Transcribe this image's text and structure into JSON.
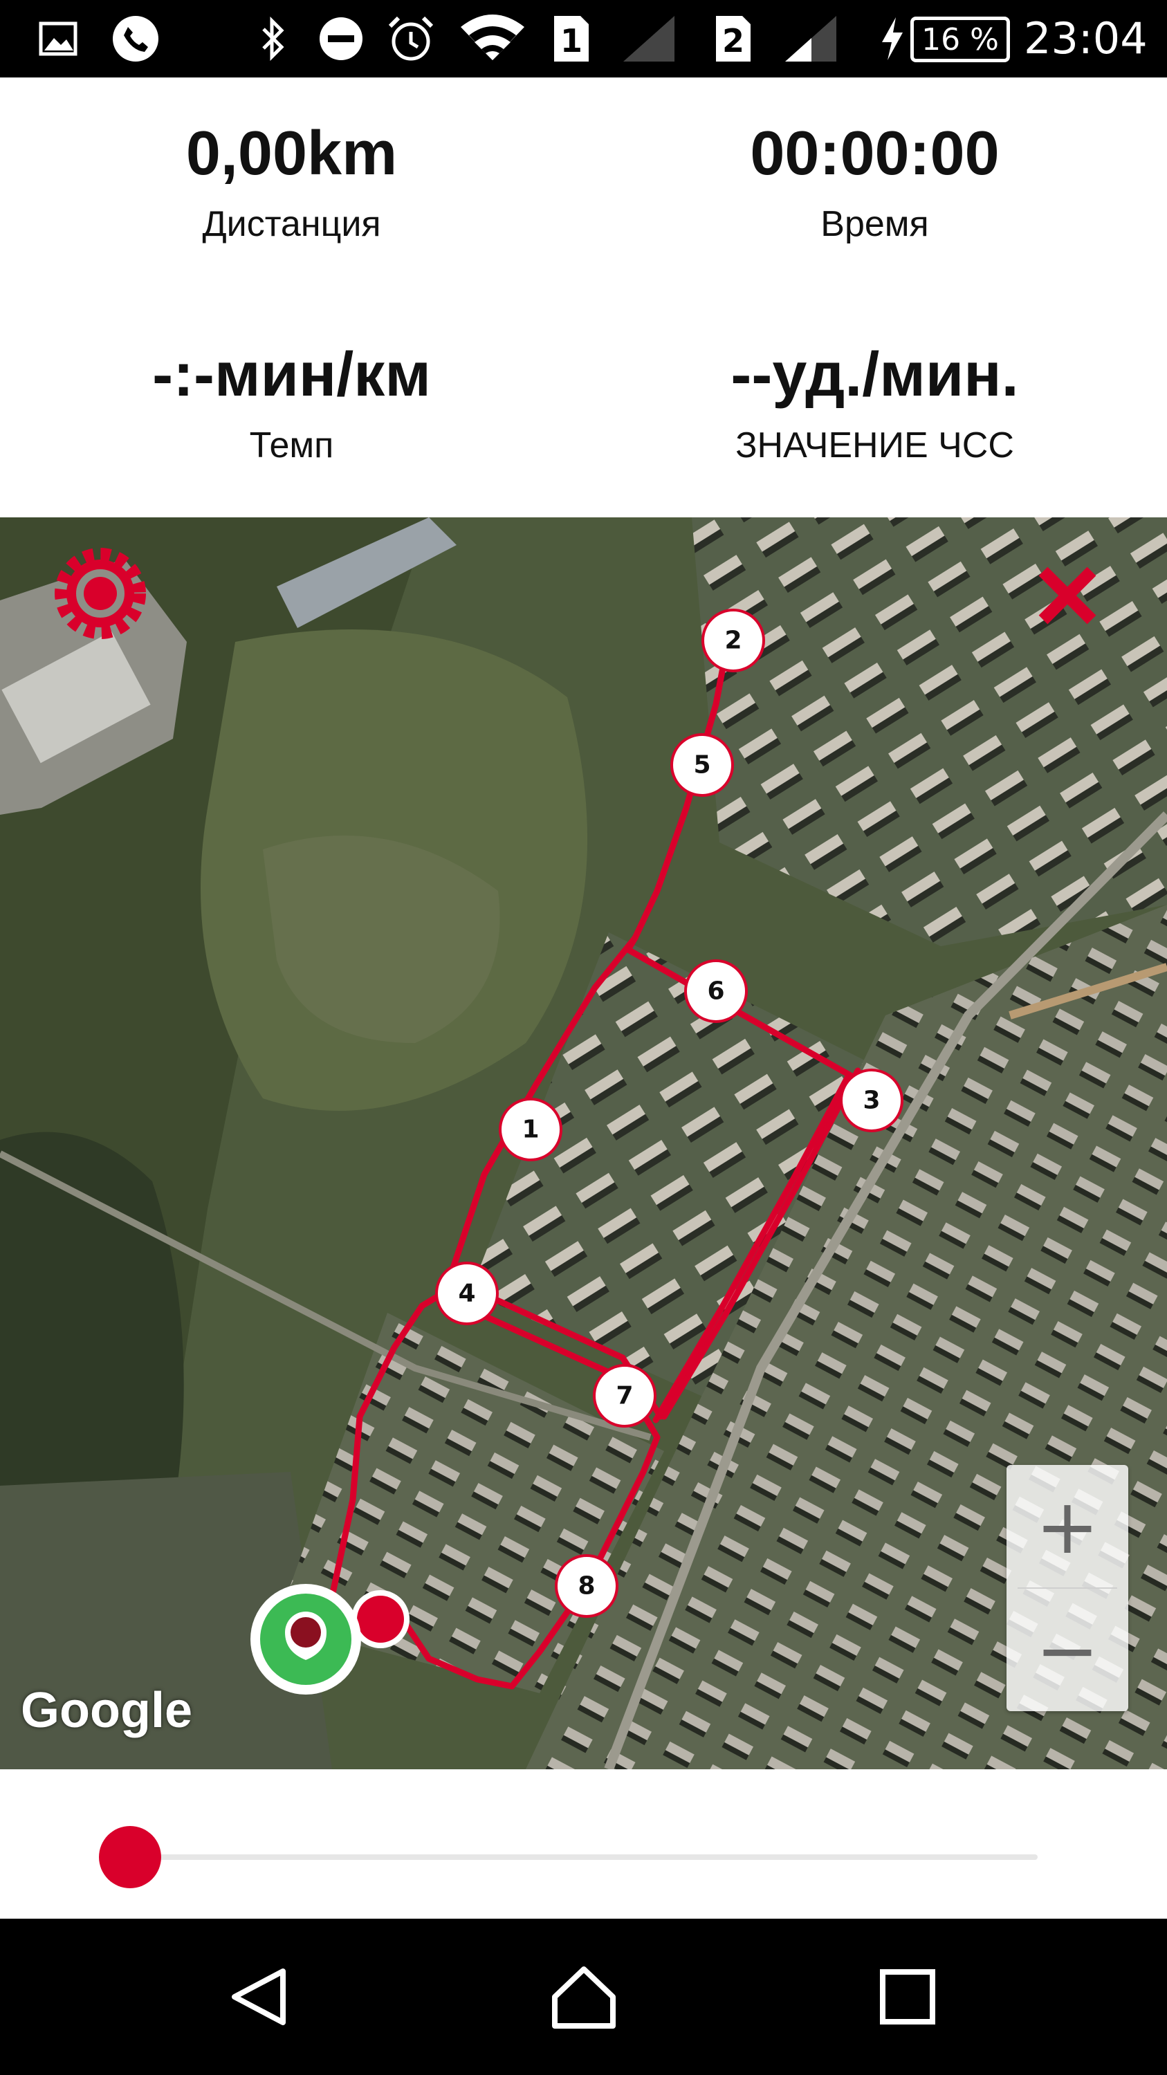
{
  "status_bar": {
    "battery_percent": "16 %",
    "time": "23:04",
    "sim1": "1",
    "sim2": "2",
    "icons": [
      "image-icon",
      "phone-icon",
      "bluetooth-icon",
      "dnd-icon",
      "alarm-icon",
      "wifi-icon",
      "sim1-icon",
      "signal-icon",
      "sim2-icon",
      "signal-icon",
      "charging-icon",
      "battery-icon"
    ]
  },
  "stats": {
    "distance": {
      "value": "0,00km",
      "label": "Дистанция"
    },
    "time": {
      "value": "00:00:00",
      "label": "Время"
    },
    "pace": {
      "value": "-:-мин/км",
      "label": "Темп"
    },
    "heart_rate": {
      "value": "--уд./мин.",
      "label": "ЗНАЧЕНИЕ ЧСС"
    }
  },
  "map": {
    "provider": "Google",
    "route_color": "#d9002b",
    "waypoints": [
      "1",
      "2",
      "3",
      "4",
      "5",
      "6",
      "7",
      "8"
    ],
    "zoom_in_label": "+",
    "zoom_out_label": "−"
  },
  "progress_slider": {
    "value_percent": 0,
    "color": "#d9002b"
  },
  "colors": {
    "accent": "#d9002b",
    "start_marker": "#3cba54"
  }
}
